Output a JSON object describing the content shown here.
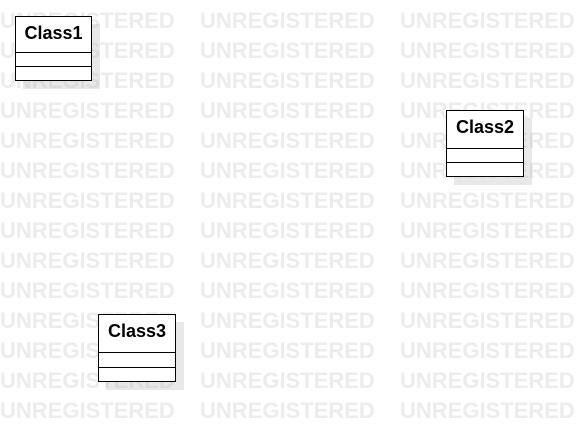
{
  "watermark": {
    "text": "UNREGISTERED",
    "color": "#ececec"
  },
  "diagram": {
    "classes": [
      {
        "name": "Class1"
      },
      {
        "name": "Class2"
      },
      {
        "name": "Class3"
      }
    ]
  }
}
